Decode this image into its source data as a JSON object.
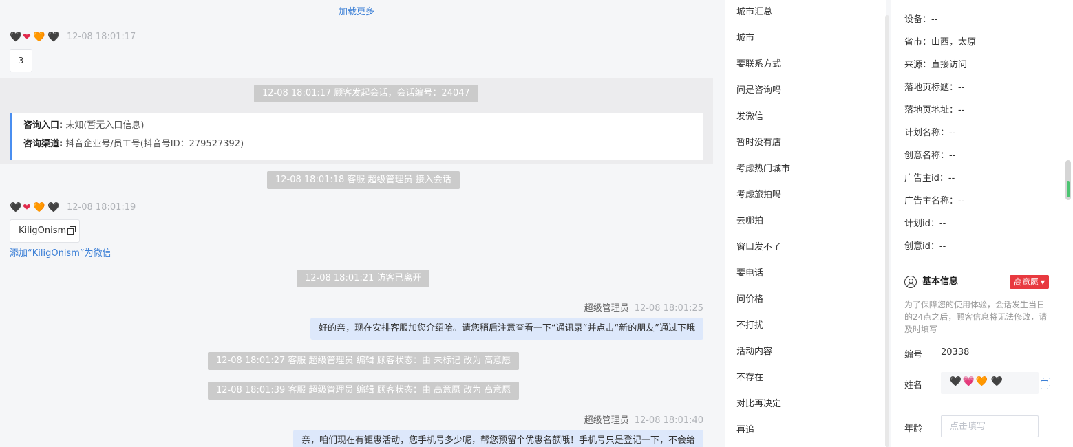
{
  "chat": {
    "load_more": "加载更多",
    "msg1": {
      "hearts": [
        "🖤",
        "❤",
        "🧡",
        "🖤"
      ],
      "time": "12-08 18:01:17",
      "content": "3"
    },
    "sys1": "12-08 18:01:17 顾客发起会话，会话编号：24047",
    "entry": {
      "label1": "咨询入口:",
      "value1": "未知(暂无入口信息)",
      "label2": "咨询渠道:",
      "value2": "抖音企业号/员工号(抖音号ID：279527392)"
    },
    "sys2": "12-08 18:01:18 客服 超级管理员 接入会话",
    "msg2": {
      "hearts": [
        "🖤",
        "❤",
        "🧡",
        "🖤"
      ],
      "time": "12-08 18:01:19",
      "content": "KiligOnism",
      "add_link": "添加“KiligOnism”为微信"
    },
    "sys3": "12-08 18:01:21 访客已离开",
    "reply1": {
      "sender": "超级管理员",
      "time": "12-08 18:01:25",
      "text": "好的亲，现在安排客服加您介绍哈。请您稍后注意查看一下“通讯录”并点击“新的朋友”通过下哦"
    },
    "sys4": "12-08 18:01:27 客服 超级管理员 编辑 顾客状态：由 未标记 改为 高意愿",
    "sys5": "12-08 18:01:39 客服 超级管理员 编辑 顾客状态：由 高意愿 改为 高意愿",
    "reply2": {
      "sender": "超级管理员",
      "time": "12-08 18:01:40",
      "text": "亲，咱们现在有钜惠活动，您手机号多少呢，帮您预留个优惠名额哦！手机号只是登记一下，不会给"
    }
  },
  "tags": [
    "城市汇总",
    "城市",
    "要联系方式",
    "问是咨询吗",
    "发微信",
    "暂时没有店",
    "考虑热门城市",
    "考虑旅拍吗",
    "去哪拍",
    "窗口发不了",
    "要电话",
    "问价格",
    "不打扰",
    "活动内容",
    "不存在",
    "对比再决定",
    "再追"
  ],
  "visitor_info": [
    {
      "label": "设备：",
      "value": "--"
    },
    {
      "label": "省市：",
      "value": "山西，太原"
    },
    {
      "label": "来源：",
      "value": "直接访问"
    },
    {
      "label": "落地页标题：",
      "value": "--"
    },
    {
      "label": "落地页地址：",
      "value": "--"
    },
    {
      "label": "计划名称：",
      "value": "--"
    },
    {
      "label": "创意名称：",
      "value": "--"
    },
    {
      "label": "广告主id：",
      "value": "--"
    },
    {
      "label": "广告主名称：",
      "value": "--"
    },
    {
      "label": "计划id：",
      "value": "--"
    },
    {
      "label": "创意id：",
      "value": "--"
    }
  ],
  "basic_info": {
    "title": "基本信息",
    "intent": "高意愿",
    "notice": "为了保障您的使用体验，会话发生当日的24点之后，顾客信息将无法修改，请及时填写",
    "id_label": "编号",
    "id_value": "20338",
    "name_label": "姓名",
    "name_hearts": [
      "🖤",
      "💗",
      "🧡",
      "🖤"
    ],
    "age_label": "年龄",
    "age_placeholder": "点击填写"
  },
  "colors": {
    "accent": "#3b7fd6",
    "badge": "#e8393f",
    "bubble": "#dde8fb",
    "entry_bar": "#4a8ef0"
  }
}
